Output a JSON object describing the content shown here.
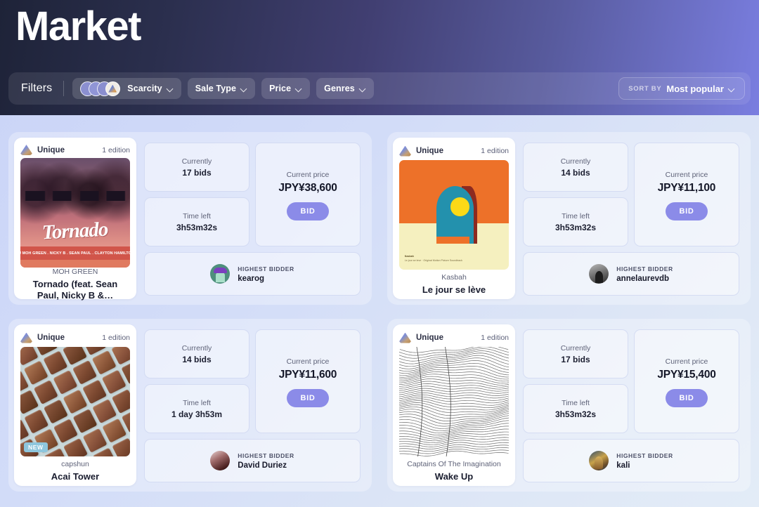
{
  "header": {
    "title": "Market",
    "filters_label": "Filters",
    "filters": [
      {
        "label": "Scarcity",
        "icon": "avatar-stack-icon",
        "has_avatars": true
      },
      {
        "label": "Sale Type",
        "icon": "chevron-down-icon",
        "has_avatars": false
      },
      {
        "label": "Price",
        "icon": "chevron-down-icon",
        "has_avatars": false
      },
      {
        "label": "Genres",
        "icon": "chevron-down-icon",
        "has_avatars": false
      }
    ],
    "sort": {
      "label": "SORT BY",
      "value": "Most popular",
      "icon": "chevron-down-icon"
    }
  },
  "labels": {
    "unique": "Unique",
    "edition": "1 edition",
    "currently": "Currently",
    "time_left": "Time left",
    "current_price": "Current price",
    "bid_button": "BID",
    "highest_bidder": "HIGHEST BIDDER",
    "new_badge": "NEW"
  },
  "colors": {
    "accent": "#8b8be8",
    "header_start": "#1e2338",
    "header_end": "#7a7ee0",
    "new_badge": "#8ec6dd",
    "panel_bg": "#ffffff"
  },
  "artwork_microtext": {
    "tornado_credits": "DJ MOH GREEN . NICKY B . SEAN PAUL . CLAYTON HAMILTON",
    "tornado_wordmark": "Tornado",
    "kasbah_title": "Kasbah",
    "kasbah_sub": "Le jour se leve  ·  Original Motion Picture Soundtrack"
  },
  "listings": [
    {
      "badge": "Unique",
      "edition": "1 edition",
      "artist": "MOH GREEN",
      "title": "Tornado (feat. Sean Paul, Nicky B &…",
      "art": "tornado",
      "is_new": false,
      "bids": "17 bids",
      "time_left": "3h53m32s",
      "price": "JPY¥38,600",
      "bid_label": "BID",
      "bidder_name": "kearog",
      "bidder_avatar": "kearog-avatar"
    },
    {
      "badge": "Unique",
      "edition": "1 edition",
      "artist": "Kasbah",
      "title": "Le jour se lève",
      "art": "kasbah",
      "is_new": false,
      "bids": "14 bids",
      "time_left": "3h53m32s",
      "price": "JPY¥11,100",
      "bid_label": "BID",
      "bidder_name": "annelaurevdb",
      "bidder_avatar": "annelaurevdb-avatar"
    },
    {
      "badge": "Unique",
      "edition": "1 edition",
      "artist": "capshun",
      "title": "Acai Tower",
      "art": "chocolate",
      "is_new": true,
      "bids": "14 bids",
      "time_left": "1 day 3h53m",
      "price": "JPY¥11,600",
      "bid_label": "BID",
      "bidder_name": "David Duriez",
      "bidder_avatar": "david-duriez-avatar"
    },
    {
      "badge": "Unique",
      "edition": "1 edition",
      "artist": "Captains Of The Imagination",
      "title": "Wake Up",
      "art": "wave",
      "is_new": false,
      "bids": "17 bids",
      "time_left": "3h53m32s",
      "price": "JPY¥15,400",
      "bid_label": "BID",
      "bidder_name": "kali",
      "bidder_avatar": "kali-avatar"
    }
  ]
}
